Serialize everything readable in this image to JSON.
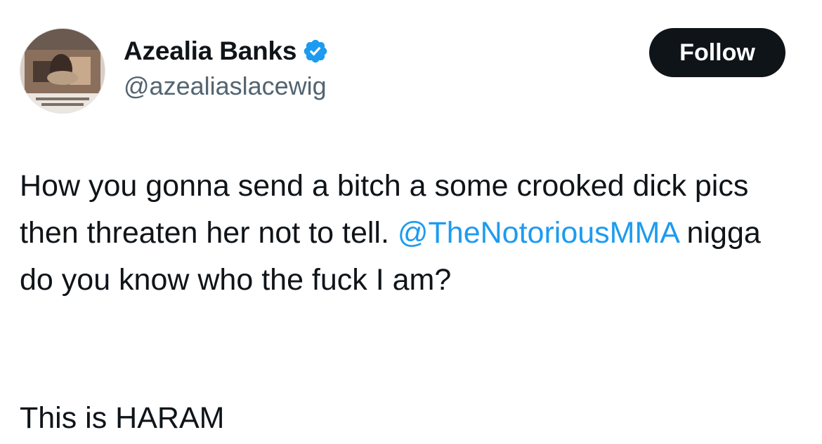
{
  "author": {
    "display_name": "Azealia Banks",
    "handle": "@azealiaslacewig",
    "verified": true,
    "verified_badge_color": "#1d9bf0"
  },
  "follow_button": {
    "label": "Follow",
    "background": "#0f1419",
    "text_color": "#ffffff"
  },
  "tweet": {
    "text_part1": "How you gonna send a bitch a some crooked dick pics then threaten her not to tell.",
    "mention": "@TheNotoriousMMA",
    "text_part2": " nigga do you know who the fuck I am?",
    "closing_line": "This is HARAM",
    "mention_color": "#1d9bf0"
  },
  "icons": {
    "verified": "verified-badge-icon"
  }
}
